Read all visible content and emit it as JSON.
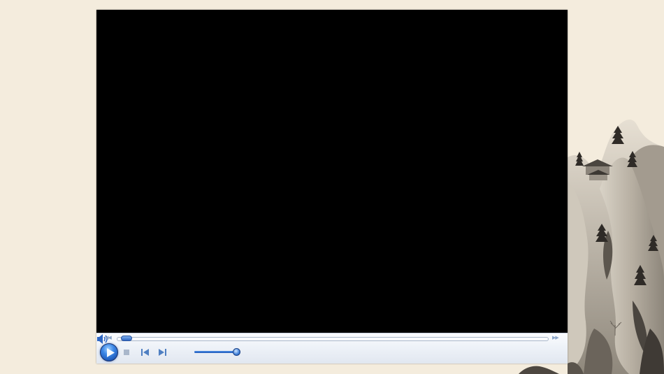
{
  "page": {
    "background": "#f4ecdd"
  },
  "player": {
    "video_background": "#000000",
    "accent": "#2f67c4",
    "seek_position": 0.01,
    "volume_level": 0.95,
    "icons": {
      "seek_back": "rewind-icon",
      "seek_forward": "fast-forward-icon",
      "play": "play-icon",
      "stop": "stop-icon",
      "previous": "previous-track-icon",
      "next": "next-track-icon",
      "mute": "speaker-icon"
    }
  },
  "scenery": {
    "description_icon": "ink-mountain-painting"
  }
}
